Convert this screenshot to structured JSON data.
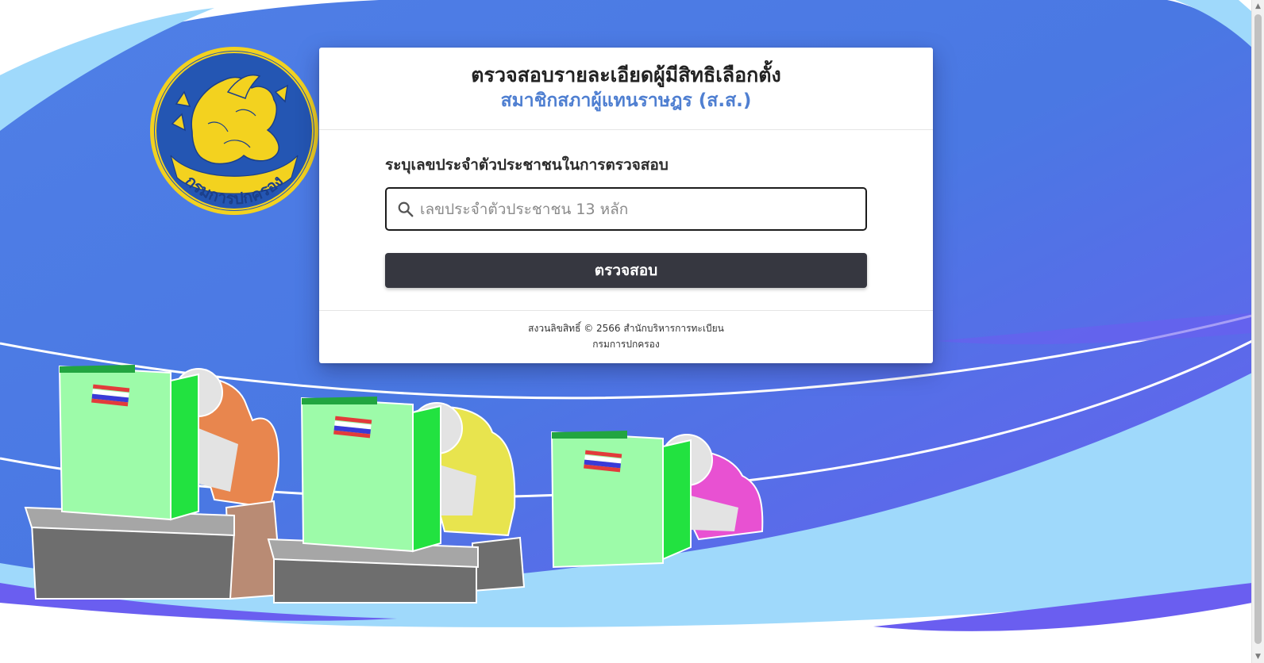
{
  "header": {
    "title": "ตรวจสอบรายละเอียดผู้มีสิทธิเลือกตั้ง",
    "subtitle": "สมาชิกสภาผู้แทนราษฎร (ส.ส.)"
  },
  "form": {
    "label": "ระบุเลขประจำตัวประชาชนในการตรวจสอบ",
    "search_placeholder": "เลขประจำตัวประชาชน 13 หลัก",
    "search_value": "",
    "submit_label": "ตรวจสอบ",
    "search_icon": "search-icon"
  },
  "footer": {
    "copyright": "สงวนลิขสิทธิ์ © 2566 สำนักบริหารการทะเบียน",
    "org": "กรมการปกครอง"
  },
  "seal": {
    "text": "กรมการปกครอง"
  },
  "colors": {
    "bg_blue": "#4f6ee8",
    "bg_purple": "#6a5ef0",
    "bg_light_blue": "#9fd9fb",
    "accent_subtitle": "#4f7fd1",
    "button": "#363740",
    "booth_green": "#9dfba9",
    "booth_dark_green": "#22e240",
    "seal_blue": "#2456b3",
    "seal_gold": "#f3d21f"
  }
}
